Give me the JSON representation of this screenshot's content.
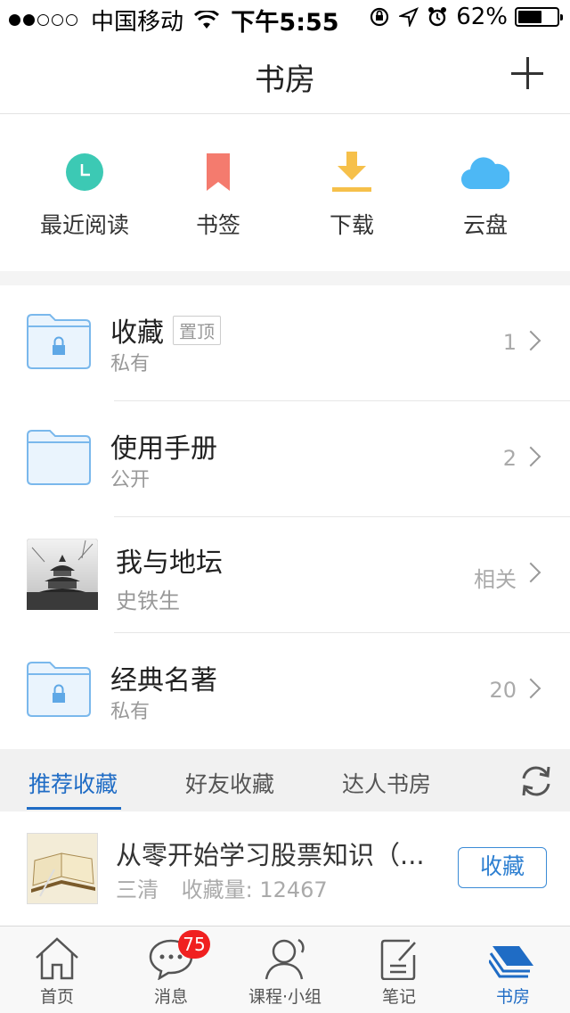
{
  "status_bar": {
    "carrier": "中国移动",
    "time": "下午5:55",
    "battery": "62%",
    "battery_level": 0.62
  },
  "nav": {
    "title": "书房"
  },
  "quick_entries": [
    {
      "label": "最近阅读",
      "icon": "clock-icon",
      "color": "#3cc9b4"
    },
    {
      "label": "书签",
      "icon": "bookmark-icon",
      "color": "#f47b6e"
    },
    {
      "label": "下载",
      "icon": "download-icon",
      "color": "#f6c04a"
    },
    {
      "label": "云盘",
      "icon": "cloud-icon",
      "color": "#4db8f5"
    }
  ],
  "shelf": [
    {
      "title": "收藏",
      "tag": "置顶",
      "subtitle": "私有",
      "count": "1",
      "icon": "locked-folder-icon"
    },
    {
      "title": "使用手册",
      "tag": "",
      "subtitle": "公开",
      "count": "2",
      "icon": "folder-icon"
    },
    {
      "title": "我与地坛",
      "tag": "",
      "subtitle": "史铁生",
      "count": "相关",
      "icon": "book-cover-image"
    },
    {
      "title": "经典名著",
      "tag": "",
      "subtitle": "私有",
      "count": "20",
      "icon": "locked-folder-icon"
    }
  ],
  "tabs": {
    "items": [
      "推荐收藏",
      "好友收藏",
      "达人书房"
    ],
    "active": 0
  },
  "recommend": {
    "title": "从零开始学习股票知识（...",
    "author": "三清",
    "collect_count": "收藏量: 12467",
    "button": "收藏"
  },
  "tabbar": {
    "items": [
      {
        "label": "首页",
        "icon": "home-icon"
      },
      {
        "label": "消息",
        "icon": "message-icon",
        "badge": "75"
      },
      {
        "label": "课程·小组",
        "icon": "person-icon"
      },
      {
        "label": "笔记",
        "icon": "note-icon"
      },
      {
        "label": "书房",
        "icon": "bookshelf-icon"
      }
    ],
    "active": 4
  },
  "colors": {
    "accent": "#1f6cc5",
    "badge": "#f02020"
  }
}
